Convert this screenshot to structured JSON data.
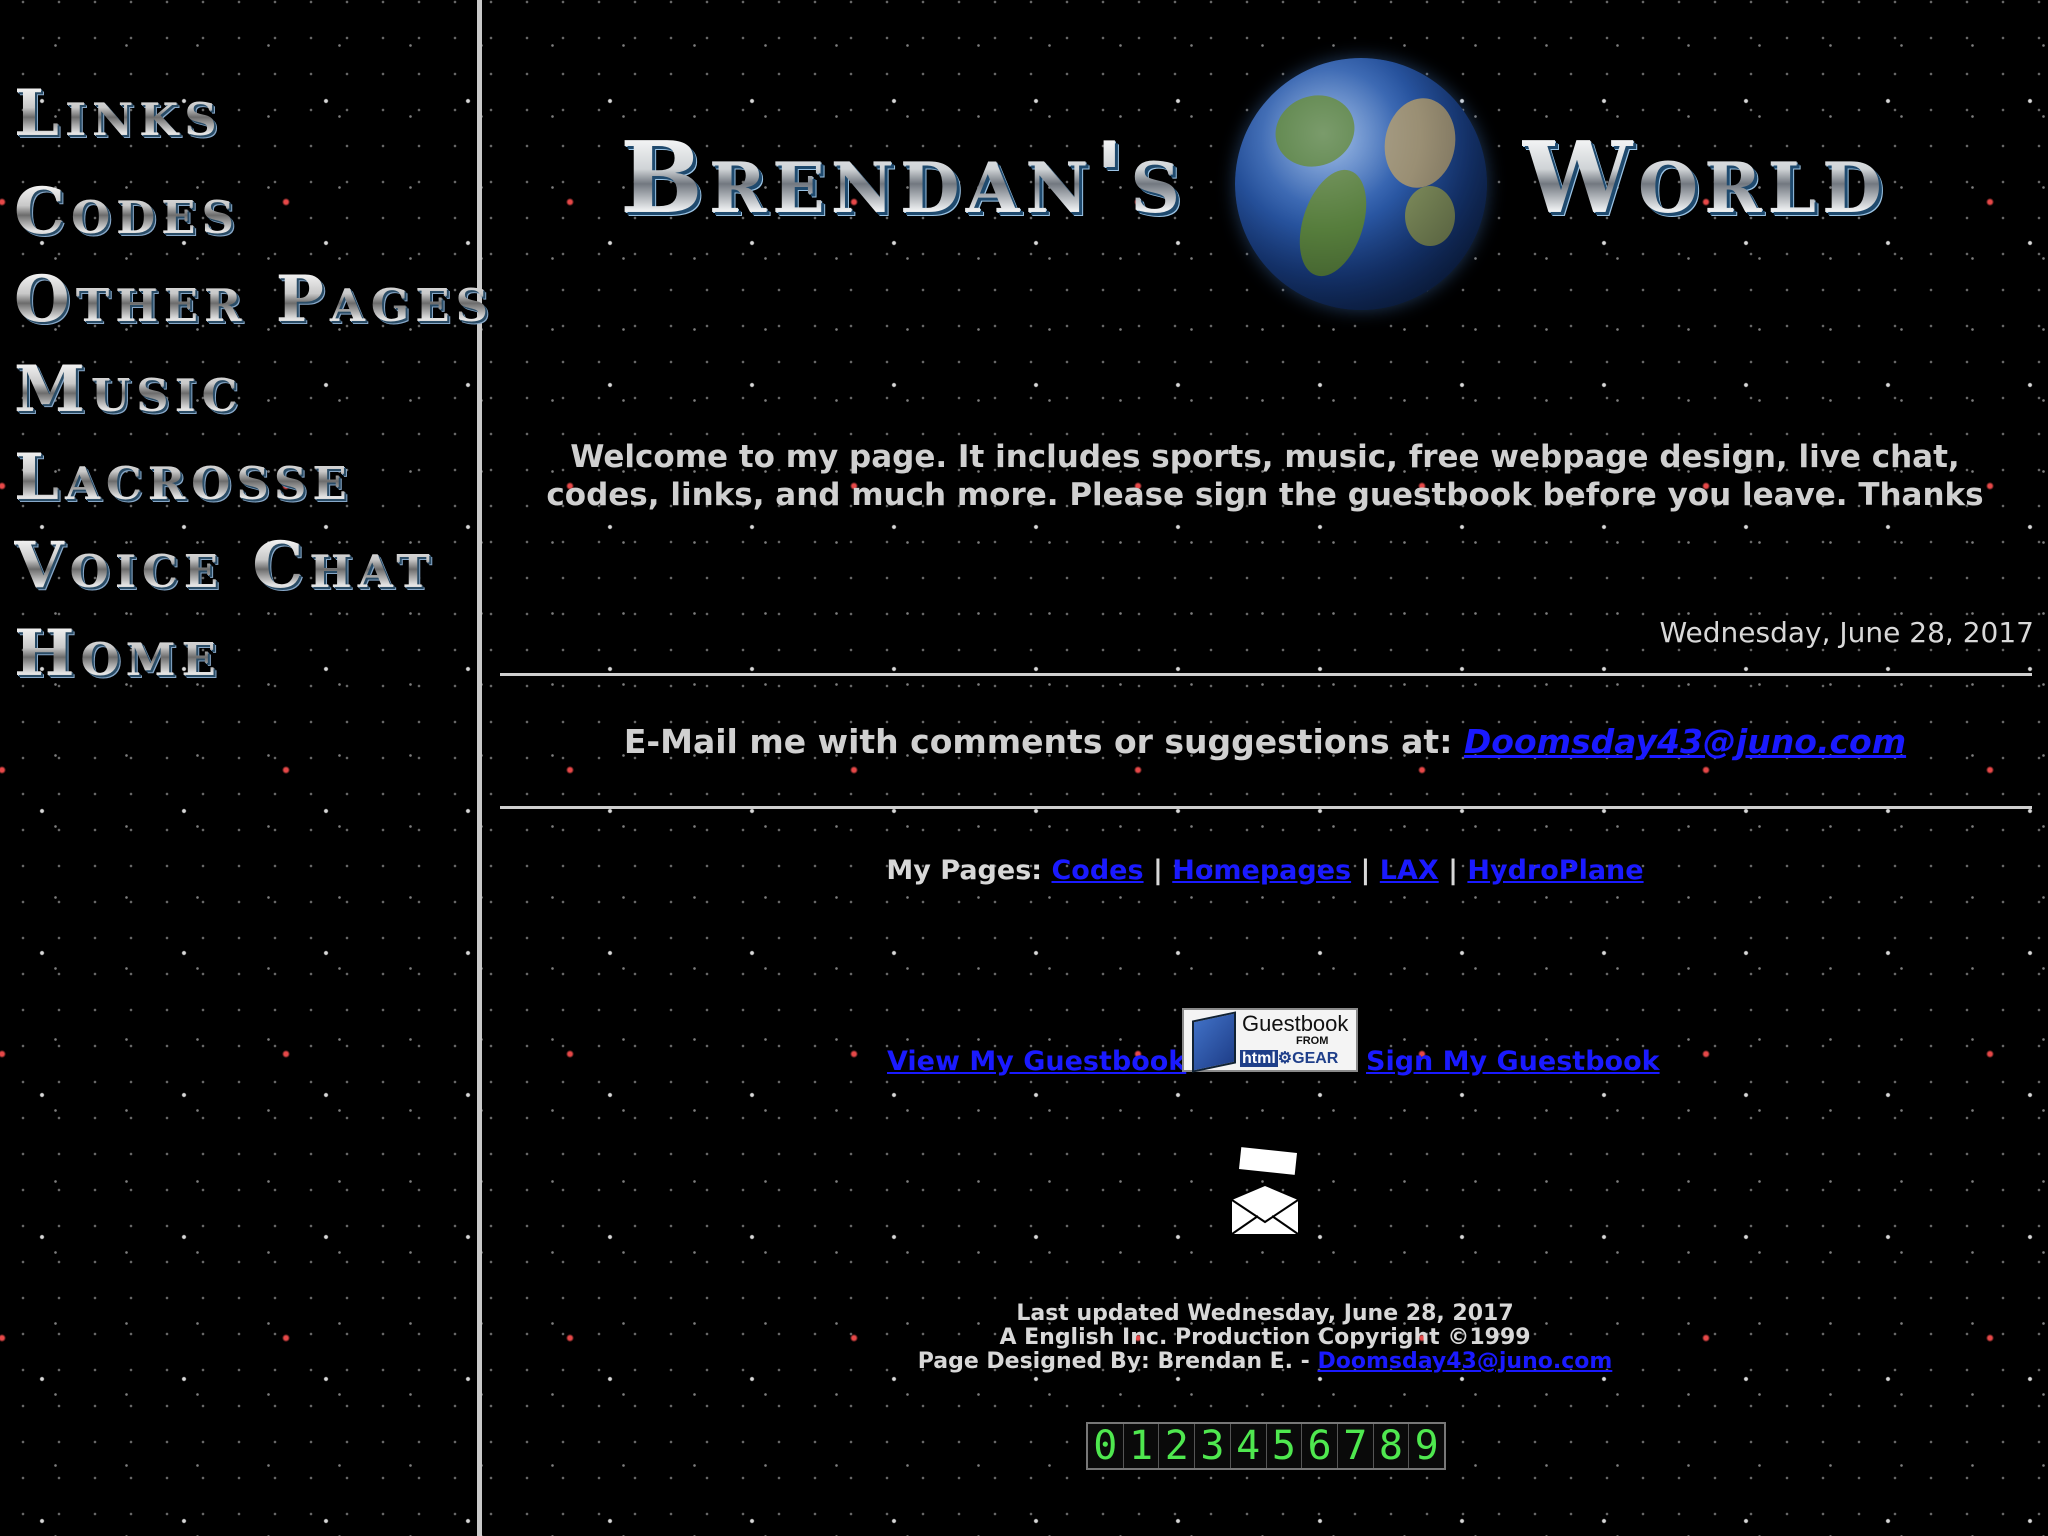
{
  "sidebar": {
    "items": [
      {
        "label": "Links"
      },
      {
        "label": "Codes"
      },
      {
        "label": "Other Pages"
      },
      {
        "label": "Music"
      },
      {
        "label": "Lacrosse"
      },
      {
        "label": "Voice Chat"
      },
      {
        "label": "Home"
      }
    ]
  },
  "header": {
    "title_left": "Brendan's",
    "title_right": "World",
    "globe_icon": "globe-icon"
  },
  "welcome_text": "Welcome to my page. It includes sports, music, free webpage design, live chat, codes, links, and much more. Please sign the guestbook before you leave. Thanks",
  "date": "Wednesday, June 28, 2017",
  "email_section": {
    "prompt": "E-Mail me with comments or suggestions at:",
    "email": "Doomsday43@juno.com"
  },
  "my_pages": {
    "label": "My Pages:",
    "separator": "|",
    "links": [
      "Codes",
      "Homepages",
      "LAX",
      "HydroPlane"
    ]
  },
  "guestbook": {
    "view_label": "View My Guestbook",
    "sign_label": "Sign My Guestbook",
    "logo_title": "Guestbook",
    "logo_from": "FROM",
    "logo_brand_1": "html",
    "logo_brand_2": "GEAR"
  },
  "mail_icon": "envelope-icon",
  "footer": {
    "line1": "Last updated Wednesday, June 28, 2017",
    "line2": "A English Inc. Production Copyright ©1999",
    "line3_prefix": "Page Designed By: Brendan E. -",
    "line3_email": "Doomsday43@juno.com"
  },
  "counter_digits": [
    "0",
    "1",
    "2",
    "3",
    "4",
    "5",
    "6",
    "7",
    "8",
    "9"
  ],
  "colors": {
    "background": "#000000",
    "link": "#1a1aff",
    "text": "#d0d0d0",
    "counter_digit": "#4fe84f"
  }
}
